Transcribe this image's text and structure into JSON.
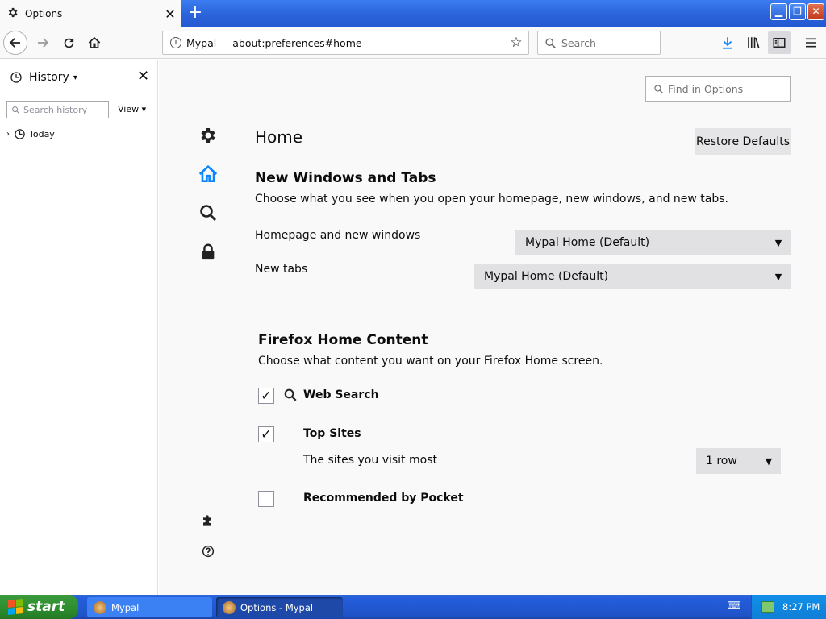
{
  "browser": {
    "tab_title": "Options",
    "url_brand": "Mypal",
    "url": "about:preferences#home",
    "search_placeholder": "Search"
  },
  "sidebar": {
    "title": "History",
    "search_placeholder": "Search history",
    "view_label": "View",
    "groups": [
      {
        "label": "Today"
      }
    ]
  },
  "preferences": {
    "find_placeholder": "Find in Options",
    "categories": [
      "gear-icon",
      "home-icon",
      "search-icon",
      "lock-icon",
      "puzzle-icon",
      "help-icon"
    ],
    "page_title": "Home",
    "restore_label": "Restore Defaults",
    "section1": {
      "title": "New Windows and Tabs",
      "description": "Choose what you see when you open your homepage, new windows, and new tabs.",
      "homepage_label": "Homepage and new windows",
      "homepage_value": "Mypal Home (Default)",
      "newtabs_label": "New tabs",
      "newtabs_value": "Mypal Home (Default)"
    },
    "section2": {
      "title": "Firefox Home Content",
      "description": "Choose what content you want on your Firefox Home screen.",
      "web_search_label": "Web Search",
      "web_search_checked": true,
      "top_sites_label": "Top Sites",
      "top_sites_checked": true,
      "top_sites_desc": "The sites you visit most",
      "rows_value": "1 row",
      "pocket_label": "Recommended by Pocket",
      "pocket_checked": false
    }
  },
  "taskbar": {
    "start_label": "start",
    "tasks": [
      {
        "label": "Mypal"
      },
      {
        "label": "Options - Mypal"
      }
    ],
    "clock": "8:27 PM"
  },
  "colors": {
    "accent": "#0a84ff",
    "titlebar": "#2a62d8",
    "taskbar": "#245edc",
    "start": "#2f8f2f"
  }
}
